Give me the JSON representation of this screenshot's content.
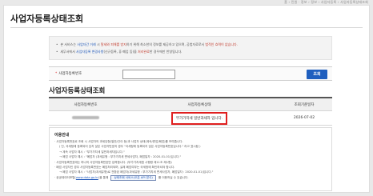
{
  "breadcrumb": "홈 › 민원 · 정보 › 정보 › 사업자등록 › 사업자등록상태조회",
  "page_title": "사업자등록상태조회",
  "notice": {
    "line1_pre": "본 서비스는 ",
    "line1_hl1": "사업자간 거래",
    "line1_mid1": " 시 ",
    "line1_hl2": "탈세와 피해를 방지",
    "line1_mid2": "하기 위해 최소한의 정보를 제공하고 있으며, 공법자료로서 ",
    "line1_hl3": "법적인 효력이 없습니다.",
    "line2_pre": "세무서에서 ",
    "line2_hl1": "사업자등록 변경사항",
    "line2_mid": "(신규등록, 휴·폐업 등)을 ",
    "line2_hl2": "처리완료",
    "line2_post": "한 경우에만 반영됩니다."
  },
  "search": {
    "label": "사업자등록번호",
    "required_mark": "*",
    "input_value": "",
    "button_label": "조회"
  },
  "result": {
    "section_title": "사업자등록상태조회",
    "columns": [
      "사업자등록번호",
      "사업자등록상태",
      "조회기준일자"
    ],
    "rows": [
      {
        "status": "부가가치세 일반과세자 입니다.",
        "date": "2026-07-02"
      }
    ]
  },
  "guide": {
    "title": "이용안내",
    "lines": [
      "· 사업자등록번호로 조회 시 사업자의 과세유형(일반/간이 등)과 사업자 상태(계속/휴업/폐업)를 보여줍니다.",
      "( 단, 국세청에 등록되어 있지 않은 사업자번호의 경우 \"국세청에 등록되지 않은 사업자등록번호입니다.\" 라고 표시됨 )",
      "→ 계속 사업자 예시 : \"부가가치세 일반과세자입니다.\"",
      "→ 폐업 사업자 예시 : \"폐업자 (과세유형 : 부가가치세 면세사업자, 폐업일자 : 2020-01-01)입니다.\"",
      "· 사업자등록번호에는 하나의 사업자등록번호만 입력합니다. (부가가치세법 시행령 제11조 제1항)",
      "· 폐업 사업자인 경우 사업자등록번호는 폐업처리되며, 실제 폐업여부는 국세청에 확인하셔야 합니다.",
      "→ 폐업 사업자 예시 : \"사업자(과세유형)로 전환된 폐업자(과세유형 : 부가가치세 면세사업자, 폐업일자 : 2020-01-01)입니다.\""
    ],
    "portal_pre": "· 공공데이터포털(",
    "portal_link": "www.data.go.kr",
    "portal_mid": ")을 통해 ",
    "portal_button": "상태조회 서비스(오픈 API 방식)",
    "portal_post": " 를 이용하실 수 있습니다."
  }
}
